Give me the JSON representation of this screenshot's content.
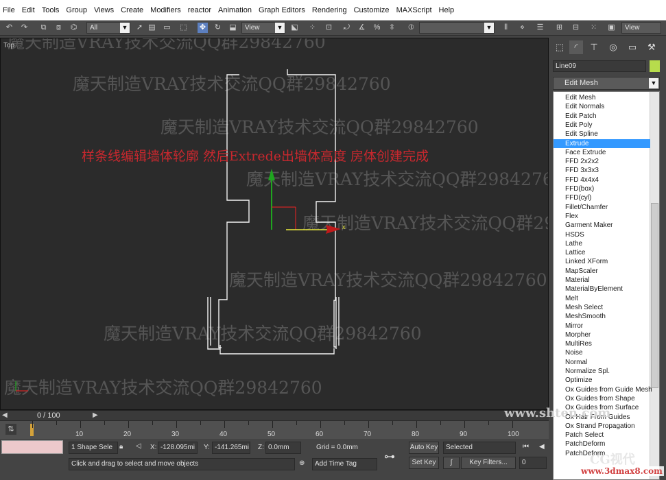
{
  "menu": [
    "File",
    "Edit",
    "Tools",
    "Group",
    "Views",
    "Create",
    "Modifiers",
    "reactor",
    "Animation",
    "Graph Editors",
    "Rendering",
    "Customize",
    "MAXScript",
    "Help"
  ],
  "toolbar": {
    "selection_filter": "All",
    "ref_coord": "View",
    "named_sel": "",
    "ref_coord_right": "View"
  },
  "viewport": {
    "label": "Top",
    "annotation": "样条线编辑墙体轮廓 然后Extrede出墙体高度 房体创建完成",
    "watermark": "魔天制造VRAY技术交流QQ群29842760",
    "gizmo_x": "x"
  },
  "command_panel": {
    "object_name": "Line09",
    "modifier_list": "Edit Mesh",
    "color_swatch": "#b7dc4c"
  },
  "modifier_dropdown": {
    "selected": "Extrude",
    "items": [
      "Edit Mesh",
      "Edit Normals",
      "Edit Patch",
      "Edit Poly",
      "Edit Spline",
      "Extrude",
      "Face Extrude",
      "FFD 2x2x2",
      "FFD 3x3x3",
      "FFD 4x4x4",
      "FFD(box)",
      "FFD(cyl)",
      "Fillet/Chamfer",
      "Flex",
      "Garment Maker",
      "HSDS",
      "Lathe",
      "Lattice",
      "Linked XForm",
      "MapScaler",
      "Material",
      "MaterialByElement",
      "Melt",
      "Mesh Select",
      "MeshSmooth",
      "Mirror",
      "Morpher",
      "MultiRes",
      "Noise",
      "Normal",
      "Normalize Spl.",
      "Optimize",
      "Ox Guides from Guide Mesh",
      "Ox Guides from Shape",
      "Ox Guides from Surface",
      "Ox Hair From Guides",
      "Ox Strand Propagation",
      "Patch Select",
      "PatchDeform",
      "PatchDeform"
    ]
  },
  "timeline": {
    "frame_label": "0 / 100",
    "ticks": [
      "10",
      "20",
      "30",
      "40",
      "50",
      "60",
      "70",
      "80",
      "90",
      "100"
    ]
  },
  "status": {
    "selection": "1 Shape Sele",
    "x_label": "X:",
    "x_value": "-128.095mi",
    "y_label": "Y:",
    "y_value": "-141.265mi",
    "z_label": "Z:",
    "z_value": "0.0mm",
    "grid": "Grid = 0.0mm",
    "prompt": "Click and drag to select and move objects",
    "add_time_tag": "Add Time Tag",
    "auto_key": "Auto Key",
    "set_key": "Set Key",
    "key_mode": "Selected",
    "key_filters": "Key Filters...",
    "frame_field": "0"
  },
  "site_watermark": "www.shten.com",
  "corner_watermark_1": "CG视代",
  "corner_watermark_2": "www.3dmax8.com"
}
